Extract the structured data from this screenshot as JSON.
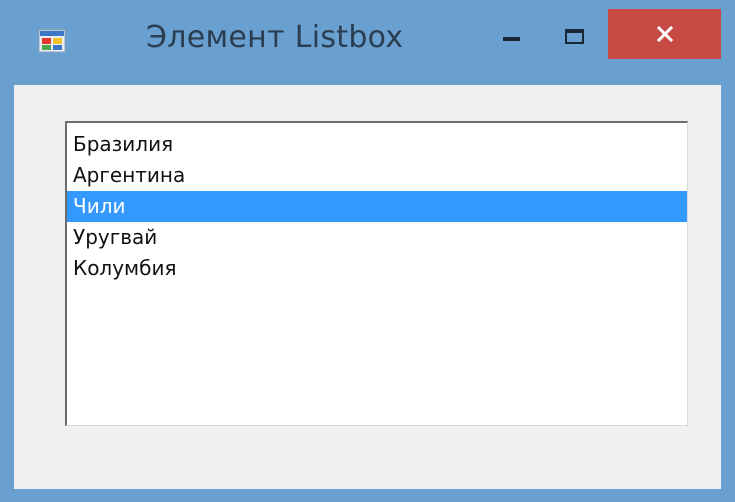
{
  "window": {
    "title": "Элемент Listbox",
    "icon": "app-form-icon",
    "controls": {
      "minimize": "minimize-icon",
      "maximize": "maximize-icon",
      "close": "close-icon"
    },
    "colors": {
      "frame": "#69a0d0",
      "close_button": "#c74a45",
      "client": "#f0f0f0",
      "selection": "#3399ff"
    }
  },
  "listbox": {
    "items": [
      {
        "label": "Бразилия",
        "selected": false
      },
      {
        "label": "Аргентина",
        "selected": false
      },
      {
        "label": "Чили",
        "selected": true
      },
      {
        "label": "Уругвай",
        "selected": false
      },
      {
        "label": "Колумбия",
        "selected": false
      }
    ]
  }
}
